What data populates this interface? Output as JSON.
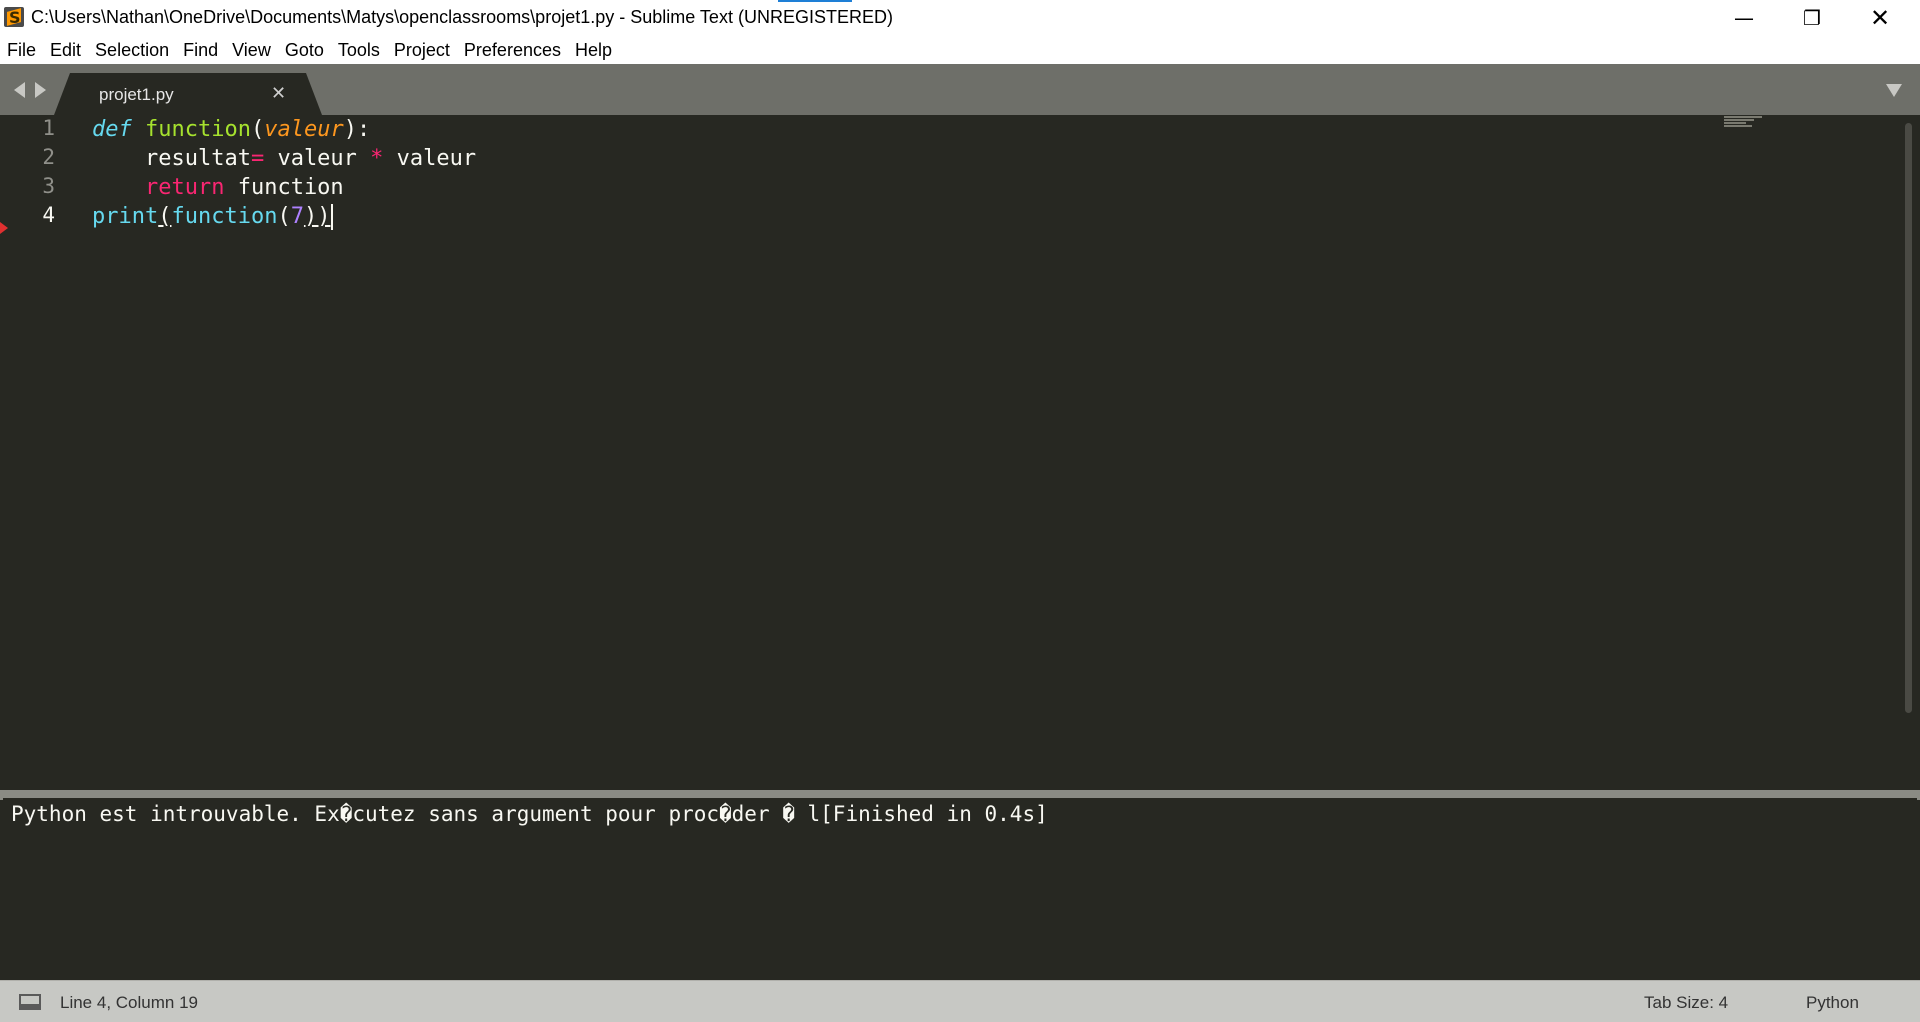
{
  "window": {
    "title": "C:\\Users\\Nathan\\OneDrive\\Documents\\Matys\\openclassrooms\\projet1.py - Sublime Text (UNREGISTERED)",
    "minimize_glyph": "—",
    "maximize_glyph": "❐",
    "close_glyph": "✕"
  },
  "menu": [
    "File",
    "Edit",
    "Selection",
    "Find",
    "View",
    "Goto",
    "Tools",
    "Project",
    "Preferences",
    "Help"
  ],
  "tabs": [
    {
      "label": "projet1.py",
      "close_glyph": "✕",
      "active": true
    }
  ],
  "editor": {
    "line_numbers": [
      "1",
      "2",
      "3",
      "4"
    ],
    "current_line": 4,
    "code": {
      "l1": {
        "kw": "def",
        "fn": "function",
        "open": "(",
        "param": "valeur",
        "close": "):"
      },
      "l2": {
        "indent": "    ",
        "lhs": "resultat",
        "op": "=",
        "mid": " valeur ",
        "star": "*",
        "rhs": " valeur"
      },
      "l3": {
        "indent": "    ",
        "kw": "return",
        "rest": " function"
      },
      "l4": {
        "print": "print",
        "open1": "(",
        "fn": "function",
        "open2": "(",
        "num": "7",
        "close": "))"
      }
    }
  },
  "output": {
    "text": "Python est introuvable. Ex�cutez sans argument pour proc�der � l[Finished in 0.4s]"
  },
  "status": {
    "position": "Line 4, Column 19",
    "tab_size": "Tab Size: 4",
    "syntax": "Python"
  },
  "colors": {
    "editor_bg": "#272822",
    "keyword": "#f92672",
    "function": "#a6e22e",
    "parameter": "#fd971f",
    "builtin": "#66d9ef",
    "number": "#ae81ff"
  }
}
